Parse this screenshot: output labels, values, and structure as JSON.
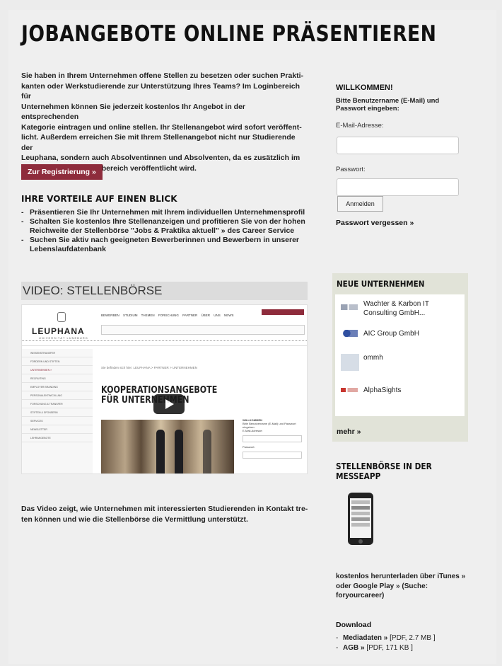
{
  "main": {
    "title": "JOBANGEBOTE ONLINE PRÄSENTIEREN",
    "intro_html_parts": [
      "Sie haben in Ihrem Unternehmen offene Stellen zu besetzen oder suchen Prakti-",
      "kanten oder Werkstudierende zur Unterstützung Ihres Teams? Im Loginbereich für",
      "Unternehmen können Sie jederzeit kostenlos Ihr Angebot in der entsprechenden",
      "Kategorie eintragen und online stellen. Ihr Stellenangebot wird sofort veröffent-",
      "licht. Außerdem erreichen Sie mit Ihrem Stellenangebot nicht nur Studierende der",
      "Leuphana, sondern auch Absolventinnen und Absolventen, da es zusätzlich im",
      "geschützten Mitgliederbereich veröffentlicht wird."
    ],
    "register_button": "Zur Registrierung »",
    "benefits_title": "IHRE VORTEILE AUF EINEN BLICK",
    "benefits": [
      "Präsentieren Sie Ihr Unternehmen mit Ihrem individuellen Unternehmensprofil",
      "Schalten Sie kostenlos Ihre Stellenanzeigen und profitieren Sie von der hohen Reichweite der Stellenbörse \"Jobs & Praktika aktuell\" » des Career Service",
      "Suchen Sie aktiv nach geeigneten Bewerberinnen und Bewerbern in unserer Lebenslaufdatenbank"
    ],
    "video_header": "VIDEO: STELLENBÖRSE",
    "video": {
      "logo": "LEUPHANA",
      "logo_sub": "UNIVERSITÄT LÜNEBURG",
      "nav": "BEWERBEN  STUDIUM  THEMEN  FORSCHUNG  PARTNER  ÜBER UNS  NEWS",
      "crumb": "Sie befinden sich hier: LEUPHANA > PARTNER > UNTERNEHMEN",
      "heading_line1": "KOOPERATIONSANGEBOTE",
      "heading_line2": "FÜR UNTERNEHMEN",
      "side_items": [
        "WISSENSTRANSFER",
        "FÖRDERN UND STIFTEN",
        "UNTERNEHMEN »",
        "RECRUITING",
        "EMPLOYER BRANDING",
        "PERSONALENTWICKLUNG",
        "FORSCHUNG & TRANSFER",
        "STIFTEN & SPONSERN",
        "SERVICES",
        "NEWSLETTER",
        "LEHRANGEBOTE"
      ],
      "rbox_title": "WILLKOMMEN",
      "rbox_text": "Bitte Benutzername (E-Mail) und Passwort eingeben:",
      "rbox_email": "E-Mail-Adresse:",
      "rbox_pw": "Passwort:"
    },
    "video_caption": "Das Video zeigt, wie Unternehmen mit interessierten Studierenden in Kontakt tre-ten können und wie die Stellenbörse die Vermittlung unterstützt."
  },
  "login": {
    "title": "WILLKOMMEN!",
    "text": "Bitte Benutzername (E-Mail) und Passwort eingeben:",
    "email_label": "E-Mail-Adresse:",
    "email_value": "",
    "password_label": "Passwort:",
    "password_value": "",
    "login_button": "Anmelden",
    "forgot": "Passwort vergessen »"
  },
  "new_companies": {
    "title": "NEUE UNTERNEHMEN",
    "items": [
      {
        "name": "Wachter & Karbon IT Consulting GmbH...",
        "logo_color": "#9aa3b4"
      },
      {
        "name": "AIC Group GmbH",
        "logo_color": "#2f4fa0"
      },
      {
        "name": "ommh",
        "logo_color": "#d6dde6"
      },
      {
        "name": "AlphaSights",
        "logo_color": "#c8362f"
      }
    ],
    "more": "mehr »"
  },
  "app": {
    "title": "STELLENBÖRSE IN DER MESSEAPP",
    "text": "kostenlos herunterladen über iTunes » oder Google Play » (Suche: foryourcareer)"
  },
  "downloads": {
    "title": "Download",
    "items": [
      {
        "label": "Mediadaten »",
        "meta": "[PDF, 2.7 MB ]"
      },
      {
        "label": "AGB »",
        "meta": "[PDF, 171 KB ]"
      }
    ]
  },
  "colors": {
    "accent": "#8e2c3c",
    "box_bg": "#e1e3d8",
    "page_bg": "#efefef"
  }
}
